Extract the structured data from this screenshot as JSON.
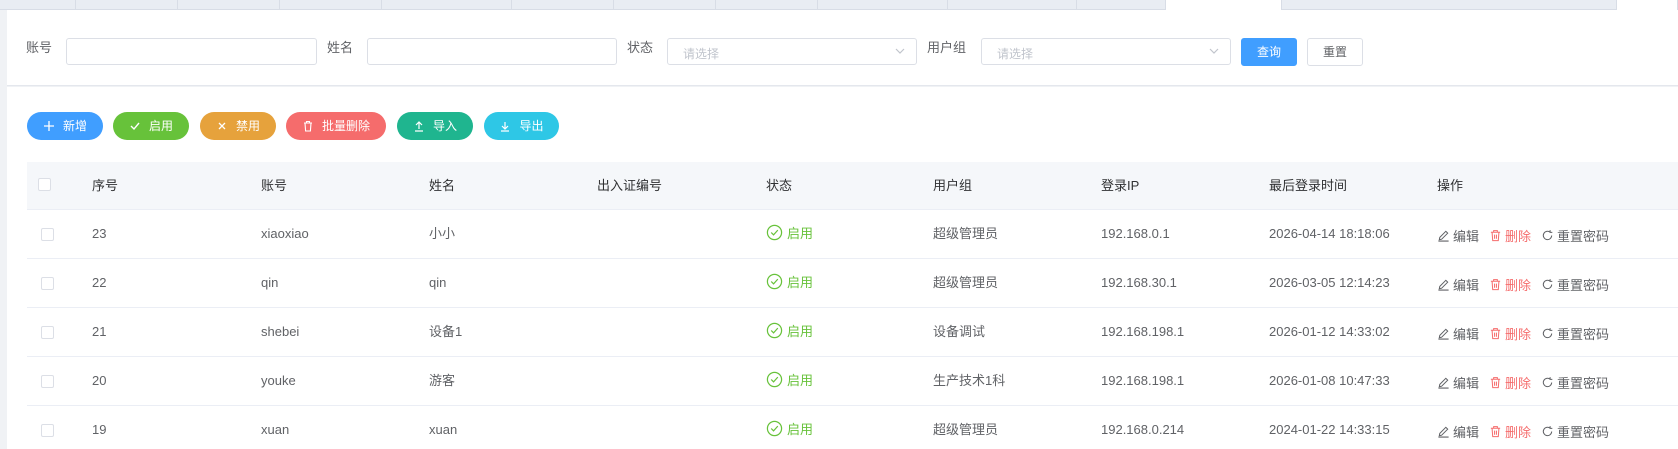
{
  "filters": {
    "account_label": "账号",
    "account_value": "",
    "name_label": "姓名",
    "name_value": "",
    "status_label": "状态",
    "status_placeholder": "请选择",
    "group_label": "用户组",
    "group_placeholder": "请选择",
    "query_label": "查询",
    "reset_label": "重置"
  },
  "toolbar": {
    "add_label": "新增",
    "enable_label": "启用",
    "disable_label": "禁用",
    "batch_delete_label": "批量删除",
    "import_label": "导入",
    "export_label": "导出"
  },
  "colors": {
    "primary": "#409eff",
    "success": "#67c23a",
    "warning": "#e6a23c",
    "danger": "#f56c6c",
    "import": "#1fb58f",
    "export": "#2ec7e6"
  },
  "table": {
    "columns": [
      "序号",
      "账号",
      "姓名",
      "出入证编号",
      "状态",
      "用户组",
      "登录IP",
      "最后登录时间",
      "操作"
    ],
    "actions": {
      "edit": "编辑",
      "delete": "删除",
      "reset_password": "重置密码"
    },
    "rows": [
      {
        "index": "23",
        "account": "xiaoxiao",
        "name": "小小",
        "pass_no": "",
        "status": "启用",
        "group": "超级管理员",
        "ip": "192.168.0.1",
        "last_login": "2026-04-14 18:18:06"
      },
      {
        "index": "22",
        "account": "qin",
        "name": "qin",
        "pass_no": "",
        "status": "启用",
        "group": "超级管理员",
        "ip": "192.168.30.1",
        "last_login": "2026-03-05 12:14:23"
      },
      {
        "index": "21",
        "account": "shebei",
        "name": "设备1",
        "pass_no": "",
        "status": "启用",
        "group": "设备调试",
        "ip": "192.168.198.1",
        "last_login": "2026-01-12 14:33:02"
      },
      {
        "index": "20",
        "account": "youke",
        "name": "游客",
        "pass_no": "",
        "status": "启用",
        "group": "生产技术1科",
        "ip": "192.168.198.1",
        "last_login": "2026-01-08 10:47:33"
      },
      {
        "index": "19",
        "account": "xuan",
        "name": "xuan",
        "pass_no": "",
        "status": "启用",
        "group": "超级管理员",
        "ip": "192.168.0.214",
        "last_login": "2024-01-22 14:33:15"
      }
    ]
  }
}
